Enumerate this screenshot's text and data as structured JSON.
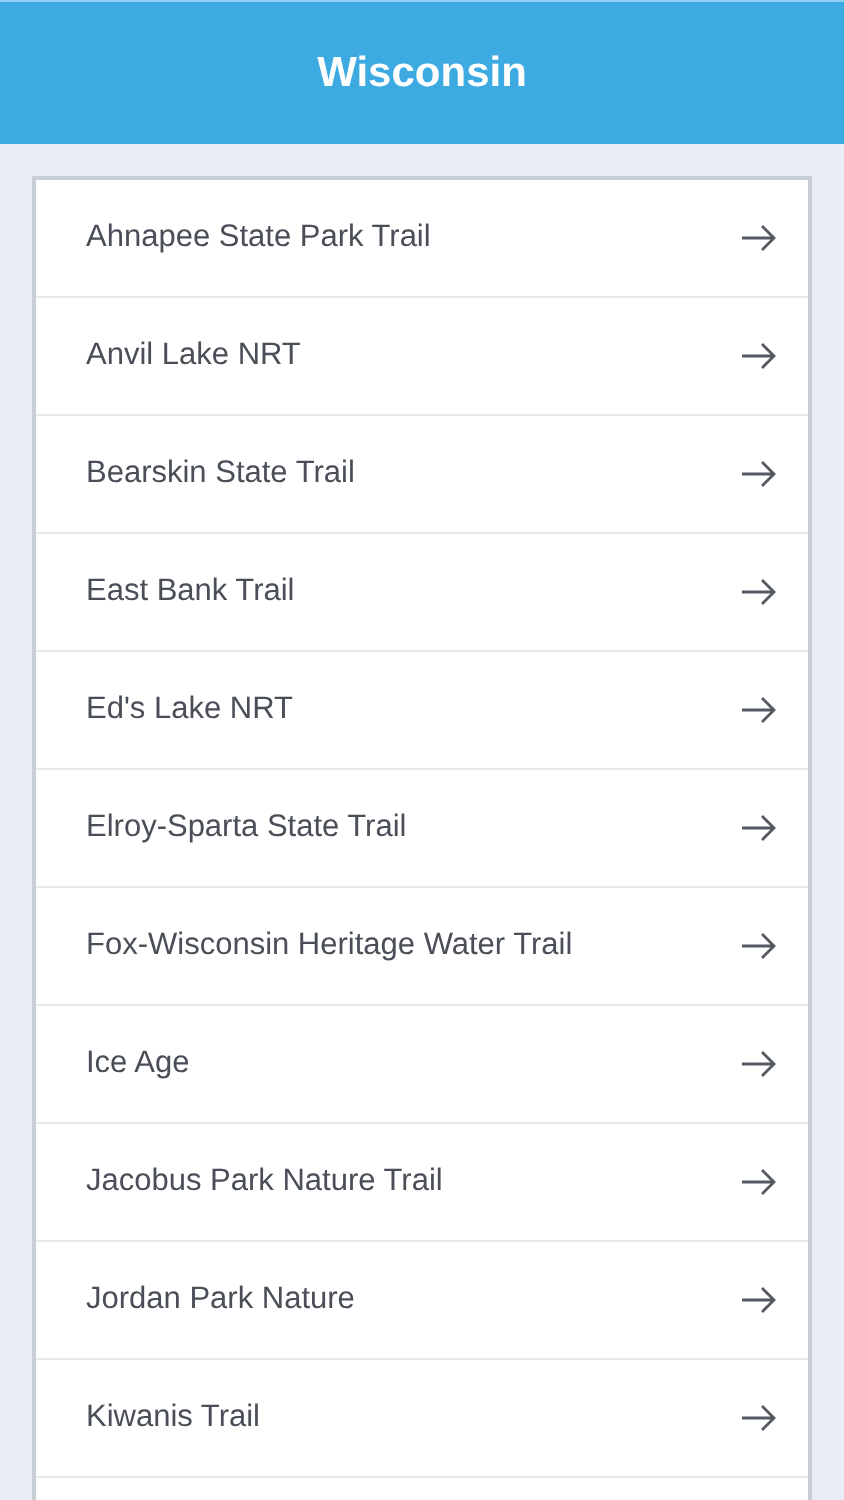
{
  "header": {
    "title": "Wisconsin"
  },
  "trails": [
    {
      "name": "Ahnapee State Park Trail"
    },
    {
      "name": "Anvil Lake NRT"
    },
    {
      "name": "Bearskin State Trail"
    },
    {
      "name": "East Bank Trail"
    },
    {
      "name": "Ed's Lake NRT"
    },
    {
      "name": "Elroy-Sparta State Trail"
    },
    {
      "name": "Fox-Wisconsin Heritage Water Trail"
    },
    {
      "name": "Ice Age"
    },
    {
      "name": "Jacobus Park Nature Trail"
    },
    {
      "name": "Jordan Park Nature"
    },
    {
      "name": "Kiwanis Trail"
    }
  ]
}
